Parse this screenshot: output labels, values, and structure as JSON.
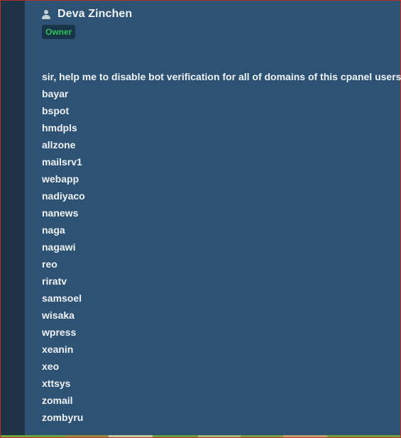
{
  "post": {
    "author": {
      "name": "Deva Zinchen",
      "badge": "Owner"
    },
    "message": {
      "intro": "sir, help me to disable bot verification for all of domains of this cpanel users,",
      "users": [
        "bayar",
        "bspot",
        "hmdpls",
        "allzone",
        "mailsrv1",
        "webapp",
        "nadiyaco",
        "nanews",
        "naga",
        "nagawi",
        "reo",
        "riratv",
        "samsoel",
        "wisaka",
        "wpress",
        "xeanin",
        "xeo",
        "xttsys",
        "zomail",
        "zombyru"
      ]
    }
  },
  "colors": {
    "background": "#2e5273",
    "sidebar": "#1f3346",
    "badge_text": "#2fbf58",
    "badge_bg": "#183448",
    "border": "#b72f2a"
  },
  "icons": {
    "author": "user-icon"
  }
}
